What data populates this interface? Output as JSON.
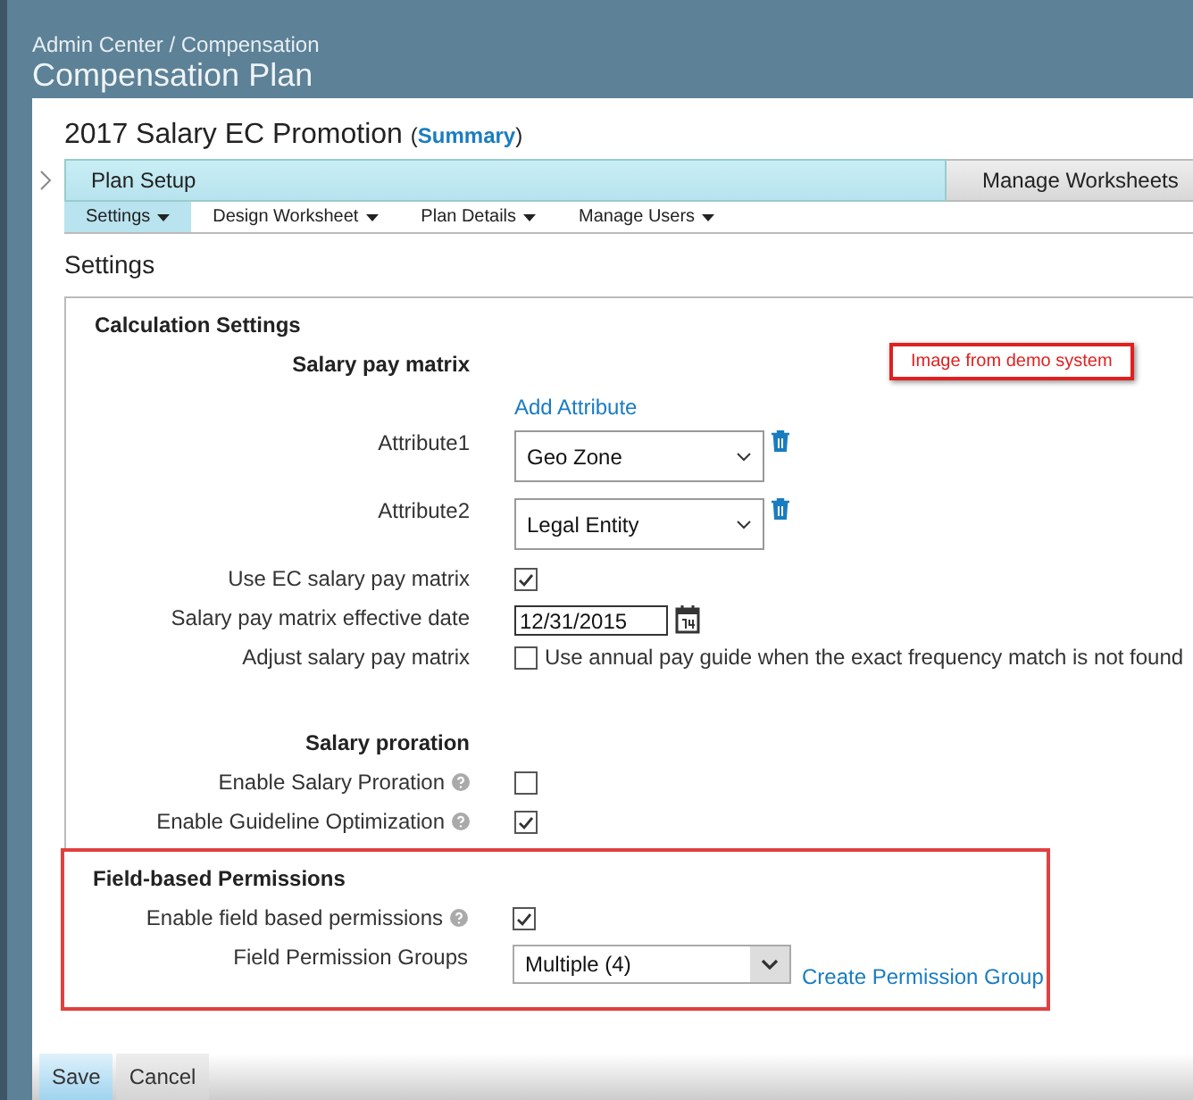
{
  "header": {
    "breadcrumb": "Admin Center / Compensation",
    "title": "Compensation Plan"
  },
  "plan": {
    "title": "2017 Salary EC Promotion",
    "summary_open": "(",
    "summary_link": "Summary",
    "summary_close": ")"
  },
  "steps": [
    {
      "label": "Plan Setup",
      "selected": true
    },
    {
      "label": "Manage Worksheets",
      "selected": false
    }
  ],
  "subtabs": [
    {
      "label": "Settings",
      "selected": true
    },
    {
      "label": "Design Worksheet",
      "selected": false
    },
    {
      "label": "Plan Details",
      "selected": false
    },
    {
      "label": "Manage Users",
      "selected": false
    }
  ],
  "page_heading": "Settings",
  "calculation": {
    "title": "Calculation Settings",
    "subsections": [
      {
        "title": "Salary pay matrix",
        "link": "Add Attribute",
        "rows": [
          {
            "kind": "select",
            "label": "Attribute1",
            "value": "Geo Zone"
          },
          {
            "kind": "select",
            "label": "Attribute2",
            "value": "Legal Entity"
          },
          {
            "kind": "checkbox",
            "label": "Use EC salary pay matrix",
            "checked": true,
            "help": false
          },
          {
            "kind": "date",
            "label": "Salary pay matrix effective date",
            "value": "12/31/2015"
          },
          {
            "kind": "checkbox_text",
            "label": "Adjust salary pay matrix",
            "checked": false,
            "text": "Use annual pay guide when the exact frequency match is not found"
          }
        ]
      },
      {
        "title": "Salary proration",
        "rows": [
          {
            "kind": "checkbox",
            "label": "Enable Salary Proration",
            "checked": false,
            "help": true
          },
          {
            "kind": "checkbox",
            "label": "Enable Guideline Optimization",
            "checked": true,
            "help": true
          }
        ]
      }
    ]
  },
  "annotation": "Image from demo system",
  "permissions": {
    "title": "Field-based Permissions",
    "rows": [
      {
        "kind": "checkbox",
        "label": "Enable field based permissions",
        "checked": true,
        "help": true
      },
      {
        "kind": "dropdown_link",
        "label": "Field Permission Groups",
        "value": "Multiple (4)",
        "link": "Create Permission Group"
      }
    ]
  },
  "buttons": [
    {
      "label": "Save",
      "kind": "primary"
    },
    {
      "label": "Cancel",
      "kind": "secondary"
    }
  ]
}
